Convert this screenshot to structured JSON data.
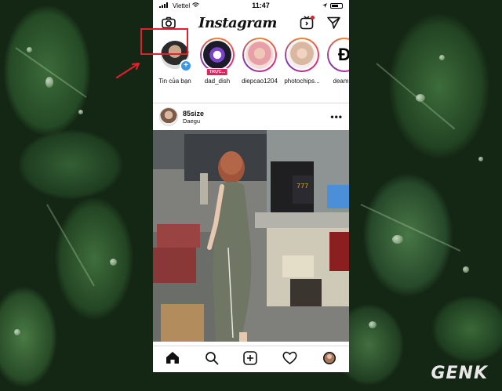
{
  "status_bar": {
    "carrier": "Viettel",
    "time": "11:47"
  },
  "app": {
    "logo": "Instagram"
  },
  "topbar": {
    "camera_icon": "camera-icon",
    "igtv_icon": "igtv-icon",
    "direct_icon": "paper-plane-icon"
  },
  "stories": [
    {
      "name": "Tin của bạn",
      "badge": "+"
    },
    {
      "name": "dad_dish",
      "badge": "TRỰC..."
    },
    {
      "name": "diepcao1204"
    },
    {
      "name": "photochips..."
    },
    {
      "name": "deamnn",
      "letter": "Đ"
    }
  ],
  "post": {
    "username": "85size",
    "location": "Daegu",
    "more": "•••"
  },
  "bottom_nav": [
    "home-icon",
    "search-icon",
    "add-post-icon",
    "heart-icon",
    "profile-icon"
  ],
  "watermark": {
    "brand": "GENK"
  },
  "colors": {
    "highlight": "#e0202a",
    "live_badge": "#e0245e",
    "plus_badge": "#3897f0"
  }
}
